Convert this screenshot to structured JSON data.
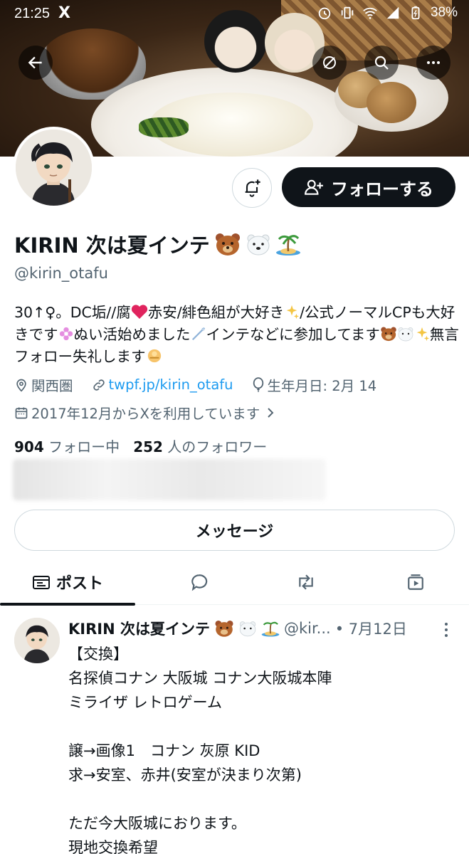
{
  "status_bar": {
    "time": "21:25",
    "app_logo": "X",
    "battery": "38%"
  },
  "profile": {
    "name": "KIRIN 次は夏インテ",
    "handle": "@kirin_otafu",
    "follow_label": "フォローする",
    "bio_lines": [
      "30↑♀。DC垢//腐",
      "赤安/緋色組が大好き",
      "/公式ノーマ",
      "ルCPも大好きです",
      "ぬい活始めました",
      "インテなどに参",
      "加してます",
      "無言フォロー失礼します"
    ],
    "location": "関西圏",
    "link": "twpf.jp/kirin_otafu",
    "birthday": "生年月日: 2月 14",
    "joined": "2017年12月からXを利用しています",
    "following_count": "904",
    "following_label": "フォロー中",
    "followers_count": "252",
    "followers_label": "人のフォロワー",
    "message_label": "メッセージ"
  },
  "tabs": {
    "posts_label": "ポスト"
  },
  "post": {
    "name": "KIRIN 次は夏インテ",
    "handle": "@kir...",
    "date": "• 7月12日",
    "lines": [
      "【交換】",
      "名探偵コナン 大阪城 コナン大阪城本陣",
      "ミライザ レトロゲーム",
      "",
      "譲→画像1　コナン 灰原 KID",
      "求→安室、赤井(安室が決まり次第)",
      "",
      "ただ今大阪城におります。",
      "現地交換希望"
    ]
  },
  "icons": {
    "back": "back-arrow-icon",
    "mute": "mute-icon",
    "search": "search-icon",
    "more": "more-icon",
    "bell": "bell-plus-icon",
    "follow": "add-user-icon",
    "location": "location-pin-icon",
    "link": "link-icon",
    "birthday": "balloon-icon",
    "calendar": "calendar-icon",
    "posts": "posts-icon",
    "replies": "reply-icon",
    "reposts": "repost-icon",
    "media": "media-icon"
  },
  "colors": {
    "accent": "#1d9bf0",
    "text": "#0f1419",
    "secondary": "#536471",
    "follow_bg": "#0f1419"
  }
}
